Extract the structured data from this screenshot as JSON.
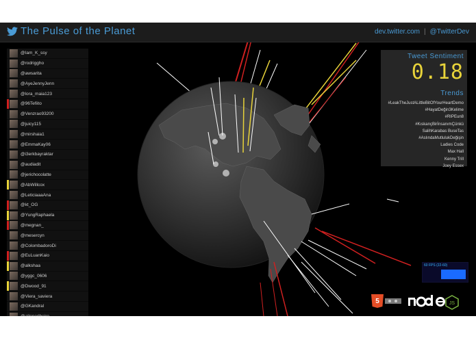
{
  "header": {
    "title": "The Pulse of the Planet",
    "link_dev": "dev.twitter.com",
    "separator": "|",
    "link_handle": "@TwitterDev",
    "brand_icon": "twitter-bird-icon"
  },
  "users": [
    {
      "handle": "@Iam_K_ssy",
      "color": ""
    },
    {
      "handle": "@rodriggho",
      "color": ""
    },
    {
      "handle": "@awsarita",
      "color": ""
    },
    {
      "handle": "@AyeJennyJenn",
      "color": ""
    },
    {
      "handle": "@lora_maia123",
      "color": ""
    },
    {
      "handle": "@96Tefiito",
      "color": "#d02020"
    },
    {
      "handle": "@Venzrao93200",
      "color": ""
    },
    {
      "handle": "@juicy115",
      "color": ""
    },
    {
      "handle": "@mirshaia1",
      "color": ""
    },
    {
      "handle": "@EmmaKay06",
      "color": ""
    },
    {
      "handle": "@i3erkbayraktar",
      "color": ""
    },
    {
      "handle": "@audiadit",
      "color": ""
    },
    {
      "handle": "@jerichocolatte",
      "color": ""
    },
    {
      "handle": "@AbWillcox",
      "color": "#e8d33a"
    },
    {
      "handle": "@LeticiaaaAna",
      "color": ""
    },
    {
      "handle": "@kt_OG",
      "color": "#d02020"
    },
    {
      "handle": "@YungRaphaela",
      "color": "#e8d33a"
    },
    {
      "handle": "@megnan_",
      "color": "#d02020"
    },
    {
      "handle": "@mesercyn",
      "color": ""
    },
    {
      "handle": "@ColombadoroDi",
      "color": ""
    },
    {
      "handle": "@EuLuanKaio",
      "color": "#d02020"
    },
    {
      "handle": "@alkshaa",
      "color": "#e8d33a"
    },
    {
      "handle": "@yggc_0606",
      "color": ""
    },
    {
      "handle": "@Dwood_91",
      "color": "#e8d33a"
    },
    {
      "handle": "@Viera_saviera",
      "color": ""
    },
    {
      "handle": "@GKandral",
      "color": ""
    },
    {
      "handle": "@alinnerlbeiro",
      "color": ""
    },
    {
      "handle": "@Batuhan_krdmn",
      "color": ""
    }
  ],
  "sentiment": {
    "label": "Tweet Sentiment",
    "value": "0.18"
  },
  "trends": {
    "label": "Trends",
    "items": [
      "#LeakTheJustALittleBitOfYourHeartDemo",
      "#HayatDeğin3Kelime",
      "#RIPEun8",
      "#KıskançBirİnsanımÇünkü",
      "SalihKarabas BuseTas",
      "#AslındaMutlulukDeğişin",
      "Ladies Code",
      "Max Hall",
      "Kenny Trill",
      "Joey Essex"
    ]
  },
  "fps": {
    "label": "60 FPS (22-60)"
  },
  "logos": [
    "html5-logo",
    "nodejs-logo"
  ],
  "colors": {
    "accent": "#4a9bd5",
    "sentiment": "#e8d33a",
    "negative": "#d02020",
    "positive": "#e8d33a"
  }
}
